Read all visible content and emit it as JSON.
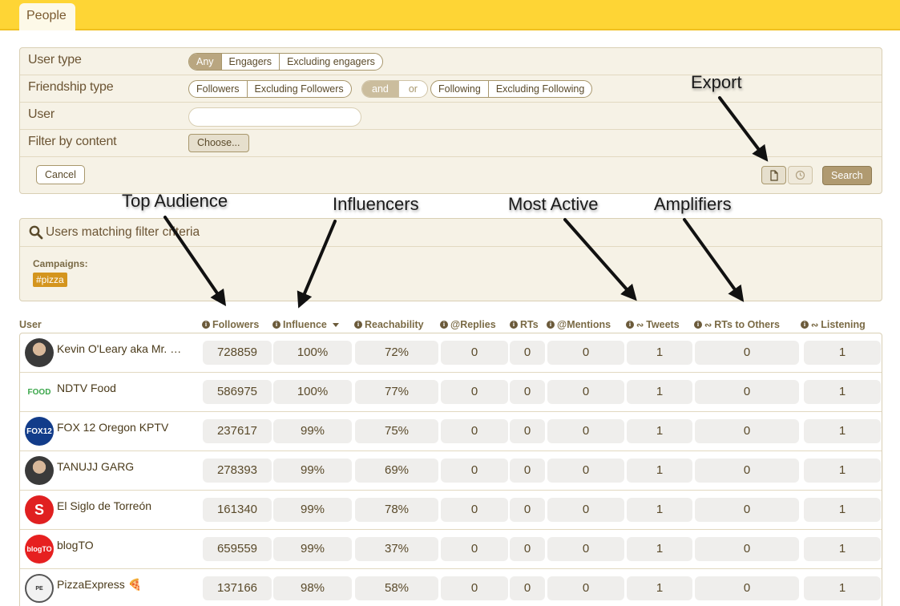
{
  "tabs": {
    "people": "People"
  },
  "filters": {
    "user_type": {
      "label": "User type",
      "options": [
        "Any",
        "Engagers",
        "Excluding engagers"
      ],
      "selected": "Any"
    },
    "friendship_type": {
      "label": "Friendship type",
      "group1": [
        "Followers",
        "Excluding Followers"
      ],
      "logic": [
        "and",
        "or"
      ],
      "logic_selected": "and",
      "group2": [
        "Following",
        "Excluding Following"
      ]
    },
    "user": {
      "label": "User",
      "value": ""
    },
    "content": {
      "label": "Filter by content",
      "button": "Choose..."
    },
    "cancel_label": "Cancel",
    "search_label": "Search"
  },
  "results": {
    "title": "Users matching filter criteria",
    "campaigns_label": "Campaigns:",
    "campaign_tag": "#pizza"
  },
  "table": {
    "headers": {
      "user": "User",
      "followers": "Followers",
      "influence": "Influence",
      "reachability": "Reachability",
      "replies": "@Replies",
      "rts": "RTs",
      "mentions": "@Mentions",
      "tweets": "Tweets",
      "rts_to_others": "RTs to Others",
      "listening": "Listening"
    },
    "rows": [
      {
        "name": "Kevin O'Leary aka Mr. Wond...",
        "avatar": "portrait",
        "followers": "728859",
        "influence": "100%",
        "reachability": "72%",
        "replies": "0",
        "rts": "0",
        "mentions": "0",
        "tweets": "1",
        "rts_to_others": "0",
        "listening": "1"
      },
      {
        "name": "NDTV Food",
        "avatar": "ndtv-food-logo",
        "followers": "586975",
        "influence": "100%",
        "reachability": "77%",
        "replies": "0",
        "rts": "0",
        "mentions": "0",
        "tweets": "1",
        "rts_to_others": "0",
        "listening": "1"
      },
      {
        "name": "FOX 12 Oregon KPTV",
        "avatar": "fox12-logo",
        "followers": "237617",
        "influence": "99%",
        "reachability": "75%",
        "replies": "0",
        "rts": "0",
        "mentions": "0",
        "tweets": "1",
        "rts_to_others": "0",
        "listening": "1"
      },
      {
        "name": "TANUJJ GARG",
        "avatar": "portrait",
        "followers": "278393",
        "influence": "99%",
        "reachability": "69%",
        "replies": "0",
        "rts": "0",
        "mentions": "0",
        "tweets": "1",
        "rts_to_others": "0",
        "listening": "1"
      },
      {
        "name": "El Siglo de Torreón",
        "avatar": "el-siglo-logo",
        "followers": "161340",
        "influence": "99%",
        "reachability": "78%",
        "replies": "0",
        "rts": "0",
        "mentions": "0",
        "tweets": "1",
        "rts_to_others": "0",
        "listening": "1"
      },
      {
        "name": "blogTO",
        "avatar": "blogto-logo",
        "followers": "659559",
        "influence": "99%",
        "reachability": "37%",
        "replies": "0",
        "rts": "0",
        "mentions": "0",
        "tweets": "1",
        "rts_to_others": "0",
        "listening": "1"
      },
      {
        "name": "PizzaExpress 🍕",
        "avatar": "pizzaexpress-logo",
        "followers": "137166",
        "influence": "98%",
        "reachability": "58%",
        "replies": "0",
        "rts": "0",
        "mentions": "0",
        "tweets": "1",
        "rts_to_others": "0",
        "listening": "1"
      }
    ]
  },
  "annotations": {
    "export": "Export",
    "top_audience": "Top Audience",
    "influencers": "Influencers",
    "most_active": "Most Active",
    "amplifiers": "Amplifiers"
  },
  "colors": {
    "header_yellow": "#fed535",
    "panel": "#f6f2e6",
    "tag": "#d4951e",
    "button_dark": "#b09a70"
  },
  "icons": {
    "search": "search-icon",
    "export": "file-icon",
    "schedule": "clock-icon",
    "info": "info-icon",
    "rss": "rss-icon"
  }
}
